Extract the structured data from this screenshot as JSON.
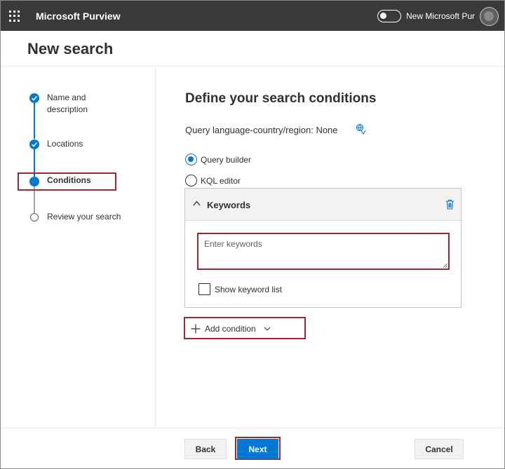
{
  "app": {
    "title": "Microsoft Purview",
    "toggle_label": "New Microsoft Pur"
  },
  "panel": {
    "title": "New search"
  },
  "steps": [
    {
      "label": "Name and description",
      "state": "done"
    },
    {
      "label": "Locations",
      "state": "done"
    },
    {
      "label": "Conditions",
      "state": "current"
    },
    {
      "label": "Review your search",
      "state": "todo"
    }
  ],
  "content": {
    "title": "Define your search conditions",
    "query_language": "Query language-country/region: None",
    "radio_query_builder": "Query builder",
    "radio_kql_editor": "KQL editor",
    "selected_mode": "Query builder"
  },
  "keywords_card": {
    "title": "Keywords",
    "input_placeholder": "Enter keywords",
    "input_value": "",
    "show_list_label": "Show keyword list",
    "show_list_checked": false
  },
  "add_condition": {
    "label": "Add condition"
  },
  "footer": {
    "back": "Back",
    "next": "Next",
    "cancel": "Cancel"
  },
  "colors": {
    "accent": "#0078d4",
    "highlight": "#a4262c",
    "topbar": "#3b3a39"
  },
  "icons": [
    "app-launcher-icon",
    "avatar",
    "check-icon",
    "globe-language-icon",
    "chevron-up-icon",
    "trash-icon",
    "plus-icon",
    "chevron-down-icon"
  ]
}
